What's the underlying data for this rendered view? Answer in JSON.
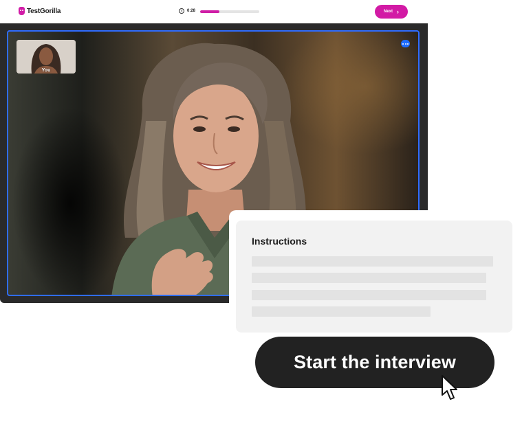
{
  "header": {
    "logo_text": "TestGorilla",
    "timer": "0:28",
    "progress": 0.33,
    "next_label": "Next"
  },
  "video": {
    "self_view_label": "You"
  },
  "instructions": {
    "title": "Instructions"
  },
  "start_button_label": "Start the interview",
  "colors": {
    "brand": "#d21aa5",
    "accent_blue": "#2f6cff",
    "button_dark": "#222222"
  },
  "icons": {
    "logo": "gorilla-logo-icon",
    "timer": "stopwatch-icon",
    "next": "chevron-right-icon",
    "more": "more-options-icon",
    "cursor": "mouse-pointer-icon"
  }
}
